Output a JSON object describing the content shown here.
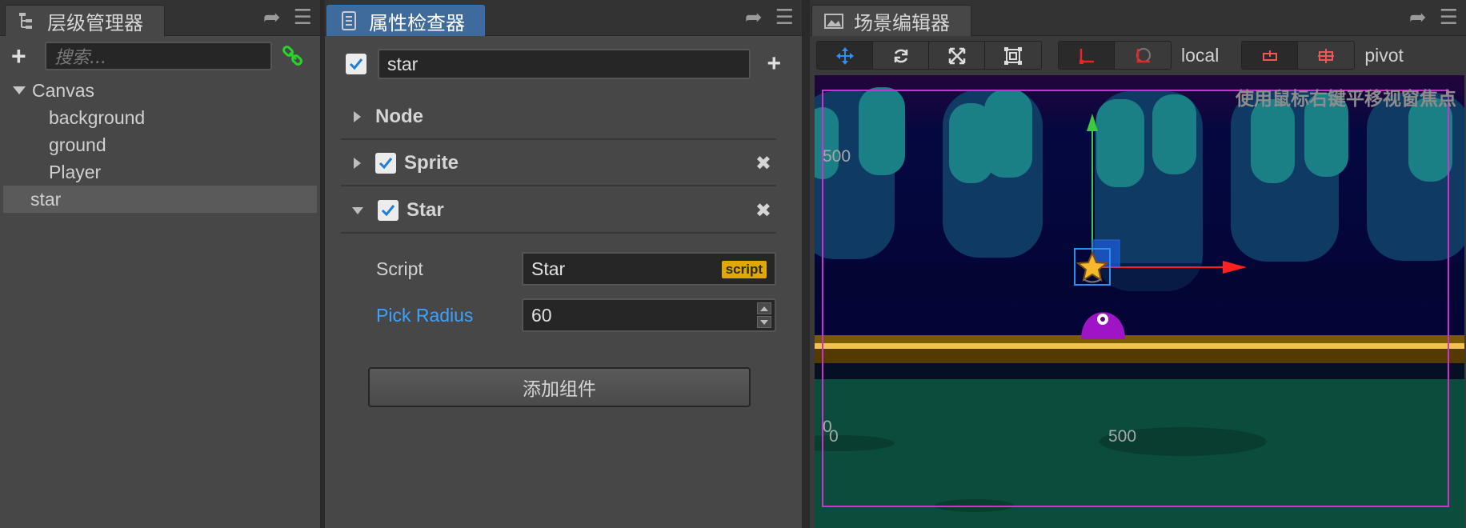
{
  "hierarchy": {
    "tab_title": "层级管理器",
    "search_placeholder": "搜索...",
    "tree": [
      {
        "label": "Canvas",
        "expanded": true,
        "depth": 0
      },
      {
        "label": "background",
        "depth": 1
      },
      {
        "label": "ground",
        "depth": 1
      },
      {
        "label": "Player",
        "depth": 1
      },
      {
        "label": "star",
        "depth": 0,
        "selected": true
      }
    ]
  },
  "inspector": {
    "tab_title": "属性检查器",
    "node_name": "star",
    "node_enabled": true,
    "components": [
      {
        "title": "Node",
        "has_checkbox": false,
        "expanded": false
      },
      {
        "title": "Sprite",
        "has_checkbox": true,
        "enabled": true,
        "expanded": false
      },
      {
        "title": "Star",
        "has_checkbox": true,
        "enabled": true,
        "expanded": true
      }
    ],
    "star_props": {
      "script_label": "Script",
      "script_value": "Star",
      "script_tag": "script",
      "pick_radius_label": "Pick Radius",
      "pick_radius_value": "60"
    },
    "add_component_label": "添加组件"
  },
  "scene": {
    "tab_title": "场景编辑器",
    "coord_mode": "local",
    "pivot_mode": "pivot",
    "hint": "使用鼠标右键平移视窗焦点",
    "axis_labels": {
      "y_500": "500",
      "y_0": "0",
      "x_0": "0",
      "x_500": "500"
    },
    "colors": {
      "accent": "#2e74c5",
      "selection": "#cc33cc",
      "x_axis": "#ff2020",
      "y_axis": "#3ec93e",
      "label_blue": "#3aa3ff"
    }
  }
}
